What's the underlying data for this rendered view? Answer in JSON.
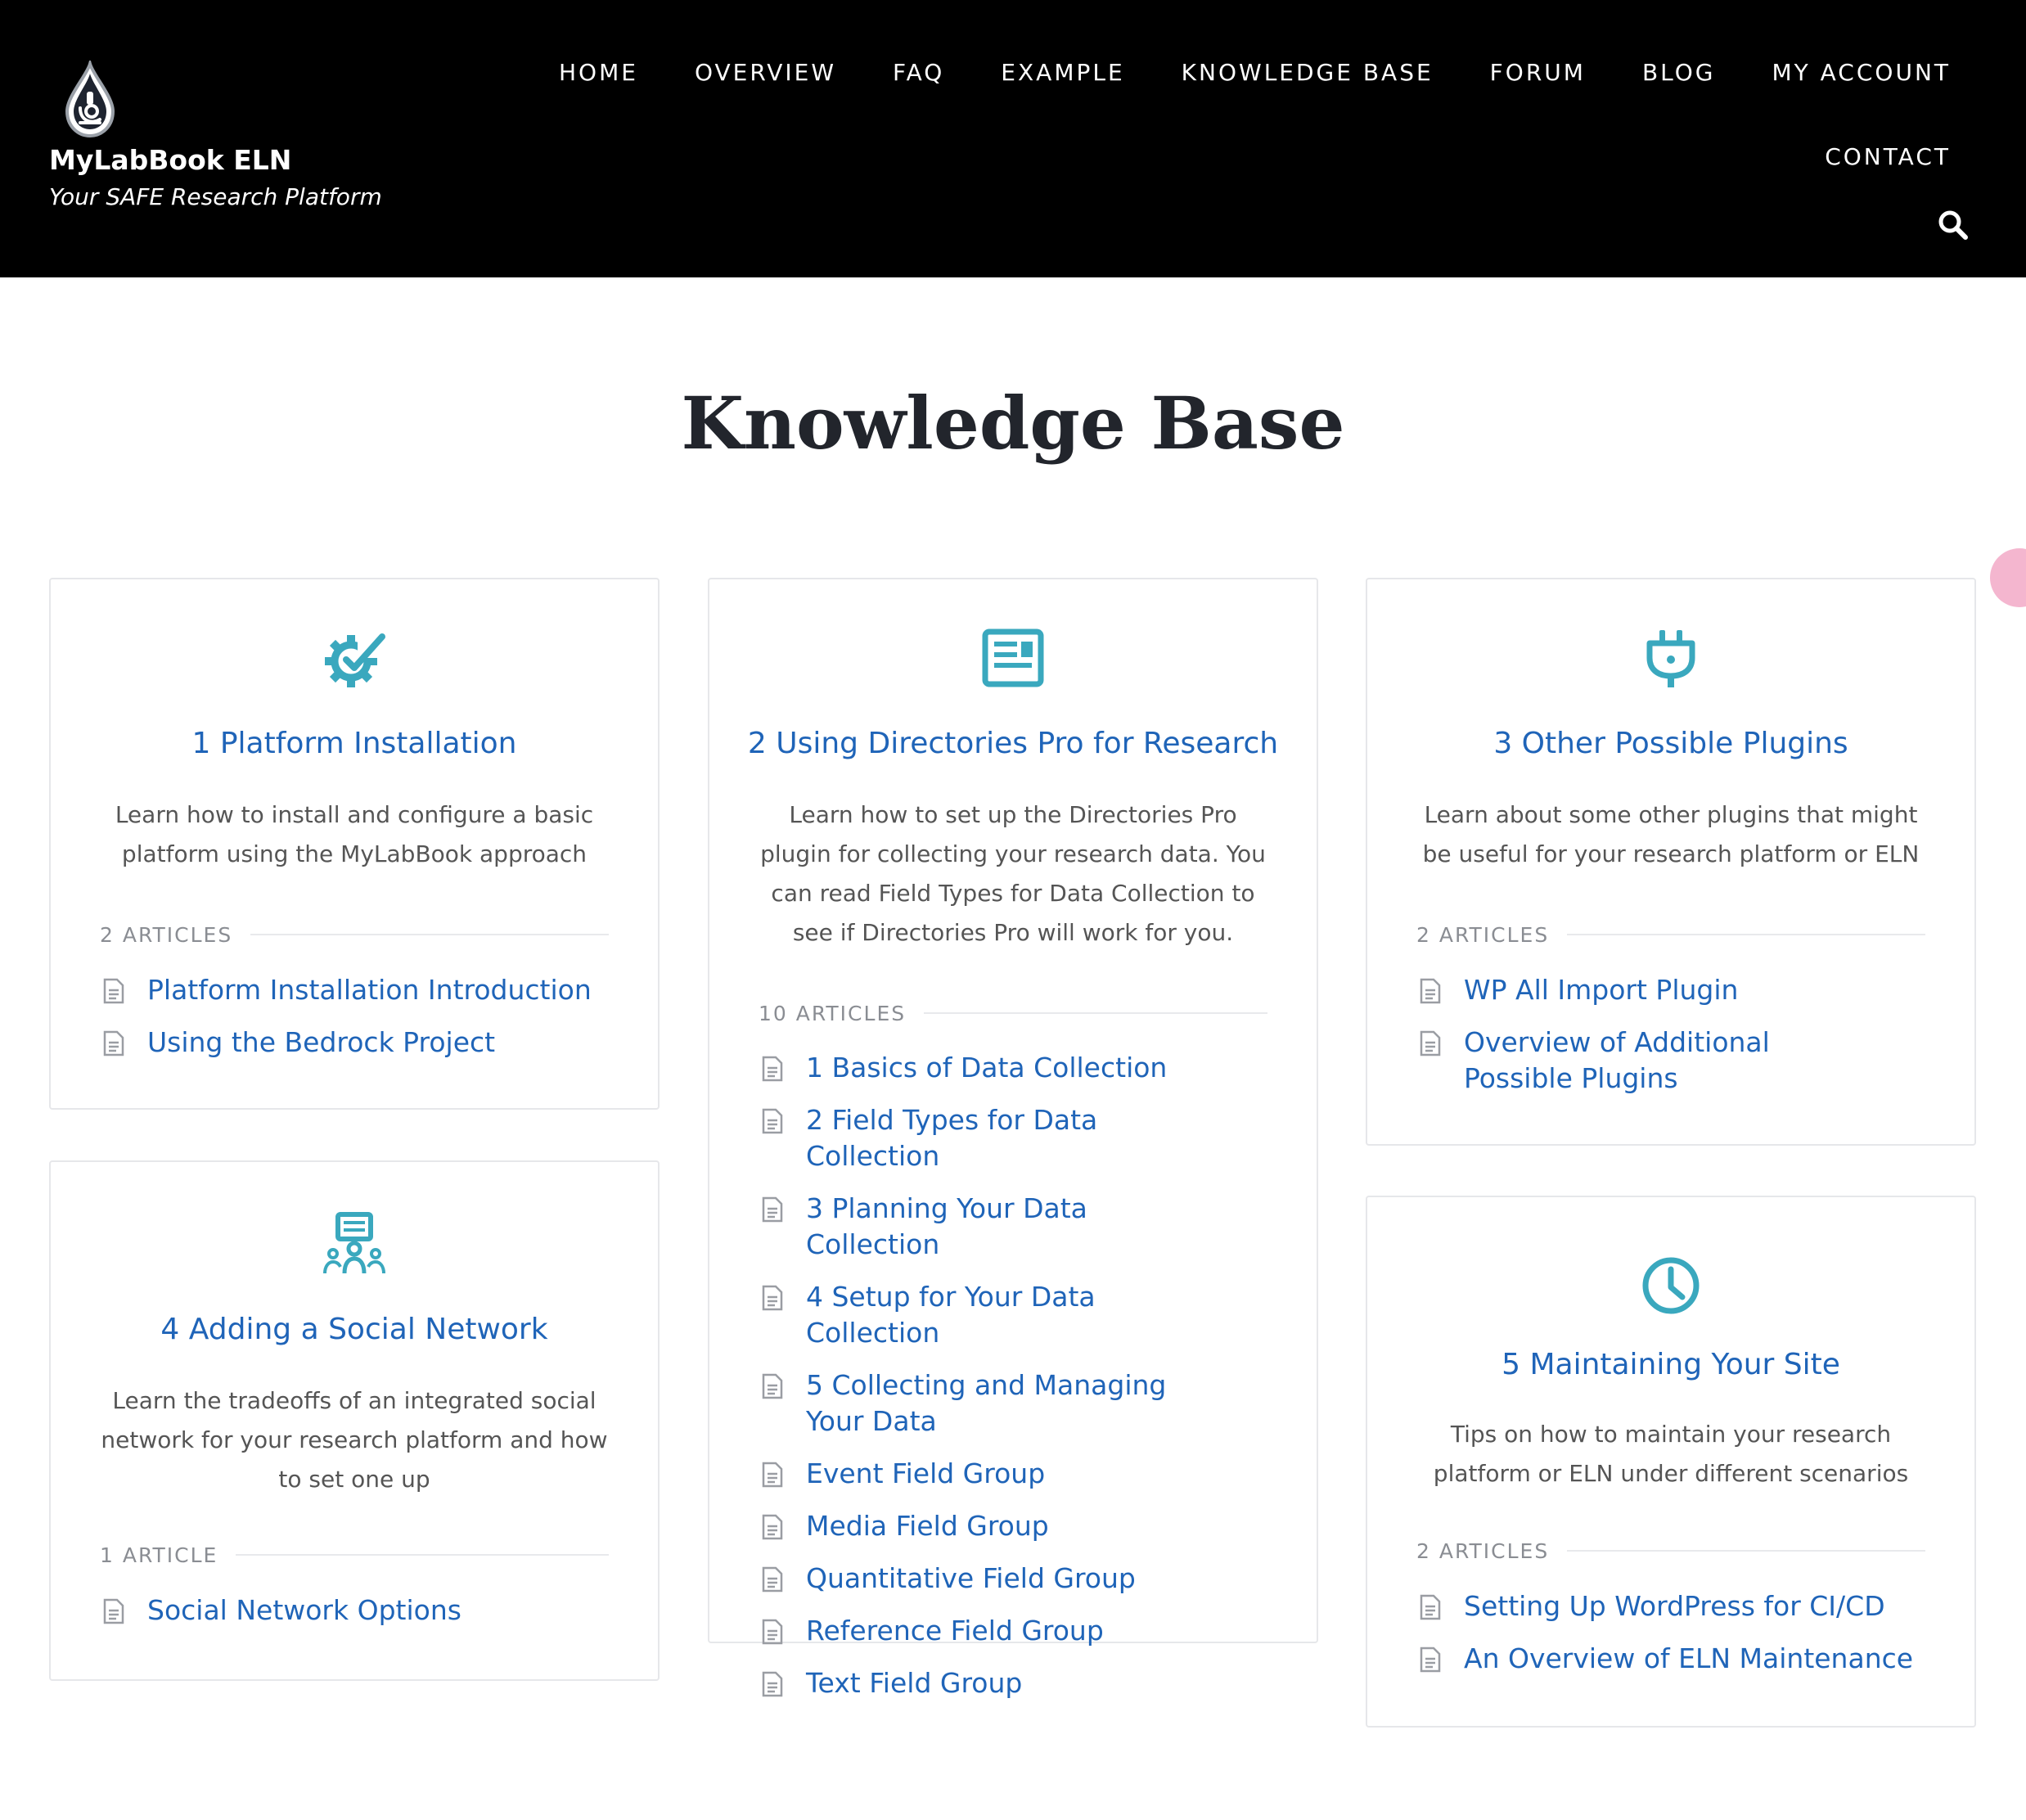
{
  "site": {
    "name": "MyLabBook ELN",
    "tagline": "Your SAFE Research Platform"
  },
  "nav": {
    "home": "HOME",
    "overview": "OVERVIEW",
    "faq": "FAQ",
    "example": "EXAMPLE",
    "knowledge_base": "KNOWLEDGE BASE",
    "forum": "FORUM",
    "blog": "BLOG",
    "my_account": "MY ACCOUNT",
    "contact": "CONTACT",
    "search_icon": "search-icon"
  },
  "page": {
    "title": "Knowledge Base"
  },
  "colors": {
    "header_bg": "#000000",
    "accent_icon": "#3aa8be",
    "link": "#1f64b8",
    "title": "#22252c"
  },
  "cards": [
    {
      "icon": "gear-check-icon",
      "title": "1 Platform Installation",
      "description": "Learn how to install and configure a basic platform using the MyLabBook approach",
      "count": "2 ARTICLES",
      "articles": [
        "Platform Installation Introduction",
        "Using the Bedrock Project"
      ]
    },
    {
      "icon": "newspaper-icon",
      "title": "2 Using Directories Pro for Research",
      "description": "Learn how to set up the Directories Pro plugin for collecting your research data. You can read Field Types for Data Collection to see if Directories Pro will work for you.",
      "count": "10 ARTICLES",
      "articles": [
        "1 Basics of Data Collection",
        "2 Field Types for Data Collection",
        "3 Planning Your Data Collection",
        "4 Setup for Your Data Collection",
        "5 Collecting and Managing Your Data",
        "Event Field Group",
        "Media Field Group",
        "Quantitative Field Group",
        "Reference Field Group",
        "Text Field Group"
      ]
    },
    {
      "icon": "plug-icon",
      "title": "3 Other Possible Plugins",
      "description": "Learn about some other plugins that might be useful for your research platform or ELN",
      "count": "2 ARTICLES",
      "articles": [
        "WP All Import Plugin",
        "Overview of Additional Possible Plugins"
      ]
    },
    {
      "icon": "social-network-icon",
      "title": "4 Adding a Social Network",
      "description": "Learn the tradeoffs of an integrated social network for your research platform and how to set one up",
      "count": "1 ARTICLE",
      "articles": [
        "Social Network Options"
      ]
    },
    {
      "icon": "clock-icon",
      "title": "5 Maintaining Your Site",
      "description": "Tips on how to maintain your research platform or ELN under different scenarios",
      "count": "2 ARTICLES",
      "articles": [
        "Setting Up WordPress for CI/CD",
        "An Overview of ELN Maintenance"
      ]
    }
  ]
}
